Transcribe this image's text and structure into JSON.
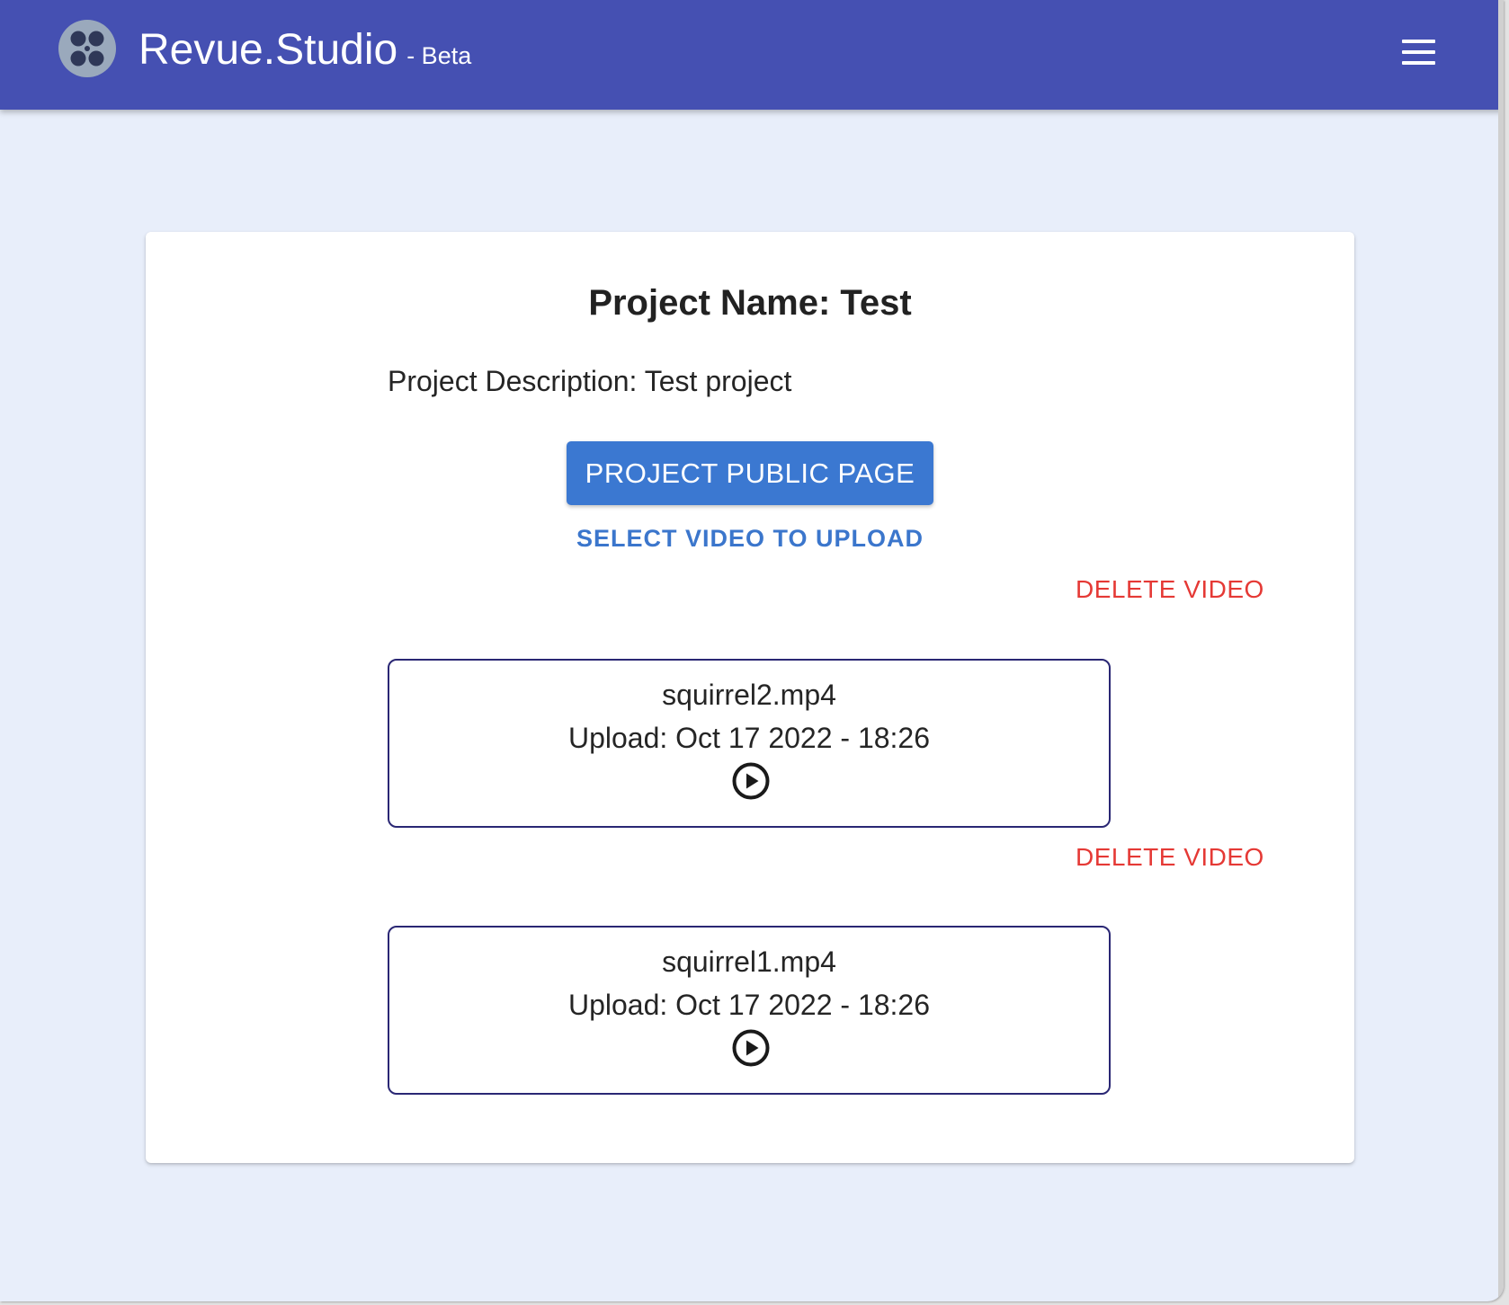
{
  "app": {
    "title": "Revue.Studio",
    "badge": "- Beta",
    "logo_icon": "film-reel-icon",
    "menu_icon": "hamburger-menu-icon"
  },
  "project": {
    "name_line": "Project Name: Test",
    "description_line": "Project Description: Test project",
    "public_page_label": "PROJECT PUBLIC PAGE",
    "upload_label": "SELECT VIDEO TO UPLOAD"
  },
  "videos": [
    {
      "delete_label": "DELETE VIDEO",
      "filename": "squirrel2.mp4",
      "upload_text": "Upload: Oct 17 2022 - 18:26",
      "play_icon": "play-circle-icon"
    },
    {
      "delete_label": "DELETE VIDEO",
      "filename": "squirrel1.mp4",
      "upload_text": "Upload: Oct 17 2022 - 18:26",
      "play_icon": "play-circle-icon"
    }
  ],
  "colors": {
    "appbar": "#4550b2",
    "page_background": "#e8eefa",
    "primary_button": "#3b78d1",
    "link_text": "#3b76cc",
    "danger_text": "#e53935",
    "video_border": "#2a2774"
  }
}
